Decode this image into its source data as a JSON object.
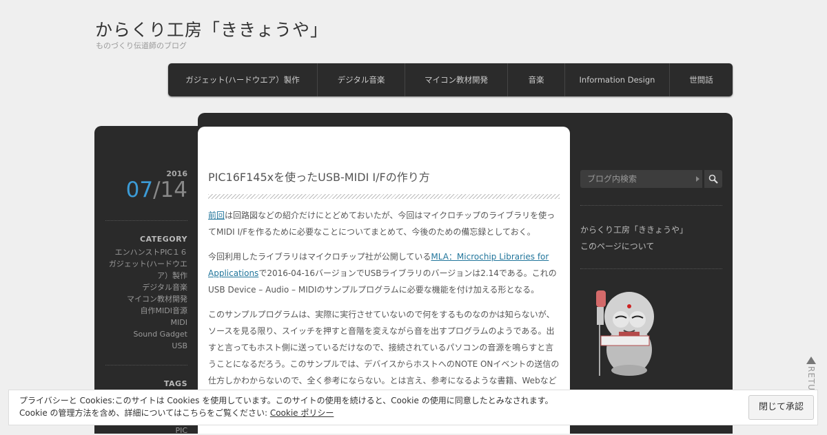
{
  "site": {
    "title": "からくり工房「ききょうや」",
    "description": "ものづくり伝道師のブログ"
  },
  "nav": {
    "items": [
      {
        "label": "ガジェット(ハードウエア）製作"
      },
      {
        "label": "デジタル音楽"
      },
      {
        "label": "マイコン教材開発"
      },
      {
        "label": "音楽"
      },
      {
        "label": "Information Design"
      },
      {
        "label": "世間話"
      }
    ]
  },
  "date": {
    "year": "2016",
    "month": "07",
    "separator": "/",
    "day": "14"
  },
  "category": {
    "heading": "CATEGORY",
    "items": [
      "エンハンストPIC１６",
      "ガジェット(ハードウエア）製作",
      "デジタル音楽",
      "マイコン教材開発",
      "自作MIDI音源",
      "MIDI",
      "Sound Gadget",
      "USB"
    ]
  },
  "tags": {
    "heading": "TAGS",
    "first": "PIC"
  },
  "post": {
    "title": "PIC16F145xを使ったUSB-MIDI I/Fの作り方",
    "p1": {
      "link": "前回",
      "text": "は回路図などの紹介だけにとどめておいたが、今回はマイクロチップのライブラリを使ってMIDI I/Fを作るために必要なことについてまとめて、今後のための備忘録としておく。"
    },
    "p2": {
      "before": "今回利用したライブラリはマイクロチップ社が公開している",
      "link": "MLA：Microchip Libraries for Applications",
      "after": "で2016-04-16バージョンでUSBライブラリのバージョンは2.14である。これのUSB Device – Audio – MIDIのサンプルプログラムに必要な機能を付け加える形となる。"
    },
    "p3": "このサンプルプログラムは、実際に実行させていないので何をするものなのかは知らないが、ソースを見る限り、スイッチを押すと音階を変えながら音を出すプログラムのようである。出すと言ってもホスト側に送っているだけなので、接続されているパソコンの音源を鳴らすと言うことになるだろう。このサンプルでは、デバイスからホストへのNOTE ONイベントの送信の仕方しかわからないので、全く参考にならない。とは言え、参考になるような書籍、Webなど"
  },
  "sidebar": {
    "search_placeholder": "ブログ内検索",
    "links": [
      "からくり工房「ききょうや」",
      "このページについて"
    ]
  },
  "return_top": "RETU",
  "cookie": {
    "line1": "プライバシーと Cookies:このサイトは Cookies を使用しています。このサイトの使用を続けると、Cookie の使用に同意したとみなされます。",
    "line2": "Cookie の管理方法を含め、詳細についてはこちらをご覧ください: ",
    "policy_link": "Cookie ポリシー",
    "close_button": "閉じて承認"
  },
  "colors": {
    "accent": "#3c9bd6",
    "link": "#21759b",
    "dark_panel": "#2a2a2a"
  },
  "icons": {
    "search": "search-icon",
    "return_top": "arrow-up-icon",
    "mascot": "mascot-image"
  }
}
